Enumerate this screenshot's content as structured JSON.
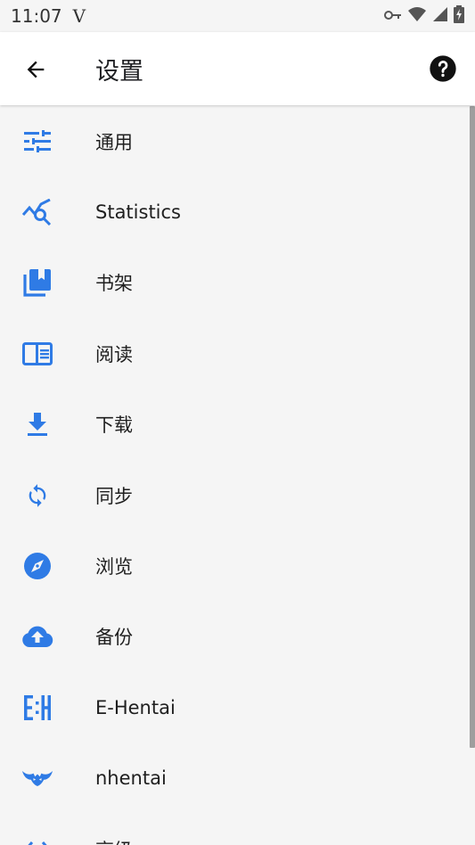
{
  "status_bar": {
    "time": "11:07",
    "carrier_glyph": "V",
    "icons": [
      "key-icon",
      "wifi-icon",
      "signal-icon",
      "battery-charging-icon"
    ]
  },
  "appbar": {
    "title": "设置",
    "back_icon": "arrow-back-icon",
    "help_icon": "help-circle-icon"
  },
  "settings": {
    "accent_color": "#2f7be5",
    "items": [
      {
        "label": "通用",
        "icon": "tune-icon"
      },
      {
        "label": "Statistics",
        "icon": "query-stats-icon"
      },
      {
        "label": "书架",
        "icon": "library-books-icon"
      },
      {
        "label": "阅读",
        "icon": "chrome-reader-mode-icon"
      },
      {
        "label": "下载",
        "icon": "download-icon"
      },
      {
        "label": "同步",
        "icon": "sync-icon"
      },
      {
        "label": "浏览",
        "icon": "explore-icon"
      },
      {
        "label": "备份",
        "icon": "cloud-upload-icon"
      },
      {
        "label": "E-Hentai",
        "icon": "ehentai-logo-icon"
      },
      {
        "label": "nhentai",
        "icon": "nhentai-logo-icon"
      },
      {
        "label": "高级",
        "icon": "code-icon"
      }
    ]
  }
}
